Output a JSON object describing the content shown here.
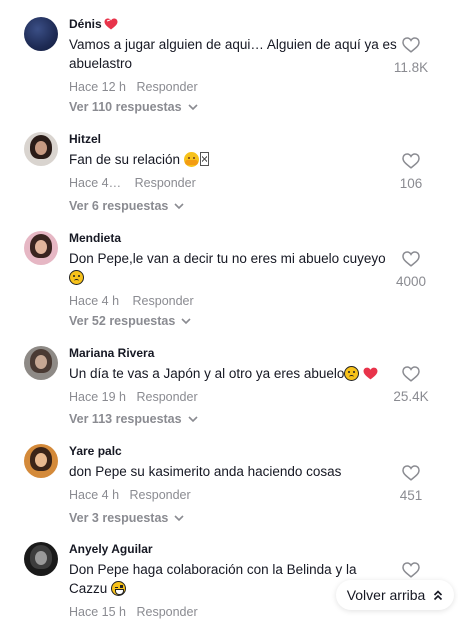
{
  "comments": [
    {
      "username": "Dénis",
      "text": "Vamos a jugar alguien de aqui… Alguien de aquí ya es abuelastro",
      "time": "Hace 12 h",
      "reply": "Responder",
      "likes": "11.8K",
      "replies": "Ver 110 respuestas"
    },
    {
      "username": "Hitzel",
      "text": "Fan de su relación",
      "time": "Hace 4…",
      "reply": "Responder",
      "likes": "106",
      "replies": "Ver 6 respuestas"
    },
    {
      "username": "Mendieta",
      "text": "Don Pepe,le van a decir tu no eres mi abuelo cuyeyo",
      "time": "Hace 4 h",
      "reply": "Responder",
      "likes": "4000",
      "replies": "Ver 52 respuestas"
    },
    {
      "username": "Mariana Rivera",
      "text": "Un día te vas a Japón y al otro ya eres abuelo",
      "time": "Hace 19 h",
      "reply": "Responder",
      "likes": "25.4K",
      "replies": "Ver 113 respuestas"
    },
    {
      "username": "Yare palc",
      "text": "don Pepe su kasimerito anda haciendo cosas",
      "time": "Hace 4 h",
      "reply": "Responder",
      "likes": "451",
      "replies": "Ver 3 respuestas"
    },
    {
      "username": "Anyely Aguilar",
      "text": "Don Pepe haga colaboración con la Belinda y la Cazzu",
      "time": "Hace 15 h",
      "reply": "Responder",
      "likes": "",
      "replies": ""
    }
  ],
  "back_to_top": "Volver arriba",
  "icons": {
    "like": "heart-outline-icon",
    "expand": "chevron-down-icon",
    "back_to_top": "double-chevron-up-icon"
  },
  "colors": {
    "primary_text": "#161823",
    "secondary_text": "#8a8b91",
    "heart_emoji": "#e8334a"
  }
}
